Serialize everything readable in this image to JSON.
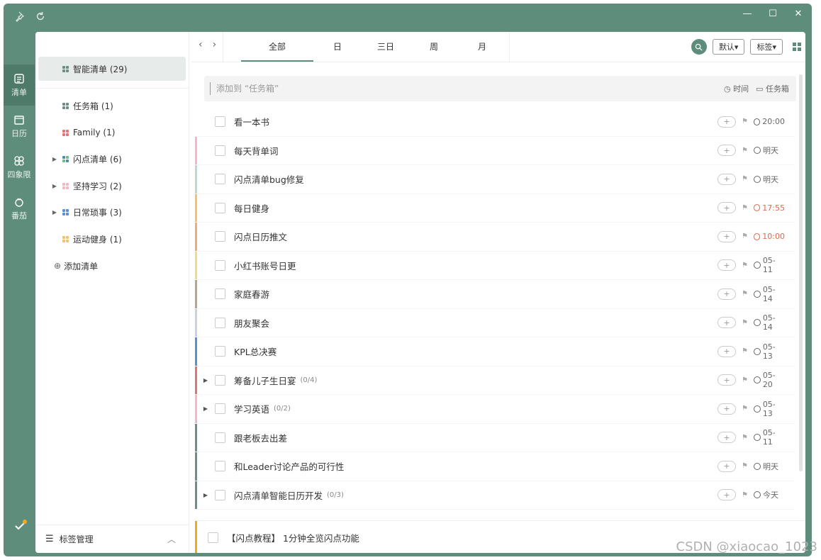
{
  "rail": {
    "items": [
      {
        "label": "清单",
        "icon": "list-icon",
        "active": true
      },
      {
        "label": "日历",
        "icon": "calendar-icon",
        "active": false
      },
      {
        "label": "四象限",
        "icon": "quadrant-icon",
        "active": false
      },
      {
        "label": "番茄",
        "icon": "tomato-icon",
        "active": false
      }
    ]
  },
  "sidebar": {
    "smart_list": "智能清单 (29)",
    "items": [
      {
        "label": "任务箱 (1)",
        "expandable": false,
        "colors": [
          "#6b8f80",
          "#6b8f80",
          "#6b8f80",
          "#6b8f80"
        ]
      },
      {
        "label": "Family (1)",
        "expandable": false,
        "colors": [
          "#e57373",
          "#e57373",
          "#e57373",
          "#e57373"
        ]
      },
      {
        "label": "闪点清单 (6)",
        "expandable": true,
        "colors": [
          "#4a90a4",
          "#6bbf8f",
          "#6bbf8f",
          "#4a90a4"
        ]
      },
      {
        "label": "坚持学习 (2)",
        "expandable": true,
        "colors": [
          "#f4b6c2",
          "#f4b6c2",
          "#f4b6c2",
          "#f4b6c2"
        ]
      },
      {
        "label": "日常琐事 (3)",
        "expandable": true,
        "colors": [
          "#5b8fd9",
          "#5b8fd9",
          "#5b8fd9",
          "#5b8fd9"
        ]
      },
      {
        "label": "运动健身 (1)",
        "expandable": false,
        "colors": [
          "#f5c26b",
          "#f5c26b",
          "#f5c26b",
          "#f5c26b"
        ]
      }
    ],
    "add_list": "添加清单",
    "footer": "标签管理"
  },
  "tabs": {
    "items": [
      "全部",
      "日",
      "三日",
      "周",
      "月"
    ],
    "active": 0,
    "default_btn": "默认▾",
    "tags_btn": "标签▾"
  },
  "add_task": {
    "placeholder": "添加到 “任务箱”",
    "time": "时间",
    "box": "任务箱"
  },
  "tasks": [
    {
      "title": "看一本书",
      "due": "20:00",
      "overdue": false,
      "color": "#ffffff",
      "expand": false,
      "count": ""
    },
    {
      "title": "每天背单词",
      "due": "明天",
      "overdue": false,
      "color": "#f4b6c2",
      "expand": false,
      "count": ""
    },
    {
      "title": "闪点清单bug修复",
      "due": "明天",
      "overdue": false,
      "color": "#b9dcc6",
      "expand": false,
      "count": ""
    },
    {
      "title": "每日健身",
      "due": "17:55",
      "overdue": true,
      "color": "#f5c26b",
      "expand": false,
      "count": ""
    },
    {
      "title": "闪点日历推文",
      "due": "10:00",
      "overdue": true,
      "color": "#f2a97f",
      "expand": false,
      "count": ""
    },
    {
      "title": "小红书账号日更",
      "due": "05-11",
      "overdue": false,
      "color": "#f5d98b",
      "expand": false,
      "count": ""
    },
    {
      "title": "家庭春游",
      "due": "05-14",
      "overdue": false,
      "color": "#b7a58f",
      "expand": false,
      "count": ""
    },
    {
      "title": "朋友聚会",
      "due": "05-14",
      "overdue": false,
      "color": "#c9d2e3",
      "expand": false,
      "count": ""
    },
    {
      "title": "KPL总决赛",
      "due": "05-13",
      "overdue": false,
      "color": "#5b8fd9",
      "expand": false,
      "count": ""
    },
    {
      "title": "筹备儿子生日宴",
      "due": "05-20",
      "overdue": false,
      "color": "#e57373",
      "expand": true,
      "count": "(0/4)"
    },
    {
      "title": "学习英语",
      "due": "05-13",
      "overdue": false,
      "color": "#f4b6c2",
      "expand": true,
      "count": "(0/2)"
    },
    {
      "title": "跟老板去出差",
      "due": "05-11",
      "overdue": false,
      "color": "#6b9080",
      "expand": false,
      "count": ""
    },
    {
      "title": "和Leader讨论产品的可行性",
      "due": "明天",
      "overdue": false,
      "color": "#6b9080",
      "expand": false,
      "count": ""
    },
    {
      "title": "闪点清单智能日历开发",
      "due": "今天",
      "overdue": false,
      "color": "#6b9080",
      "expand": true,
      "count": "(0/3)"
    }
  ],
  "bottom_task": "【闪点教程】 1分钟全览闪点功能",
  "watermark": "CSDN @xiaocao_1023"
}
